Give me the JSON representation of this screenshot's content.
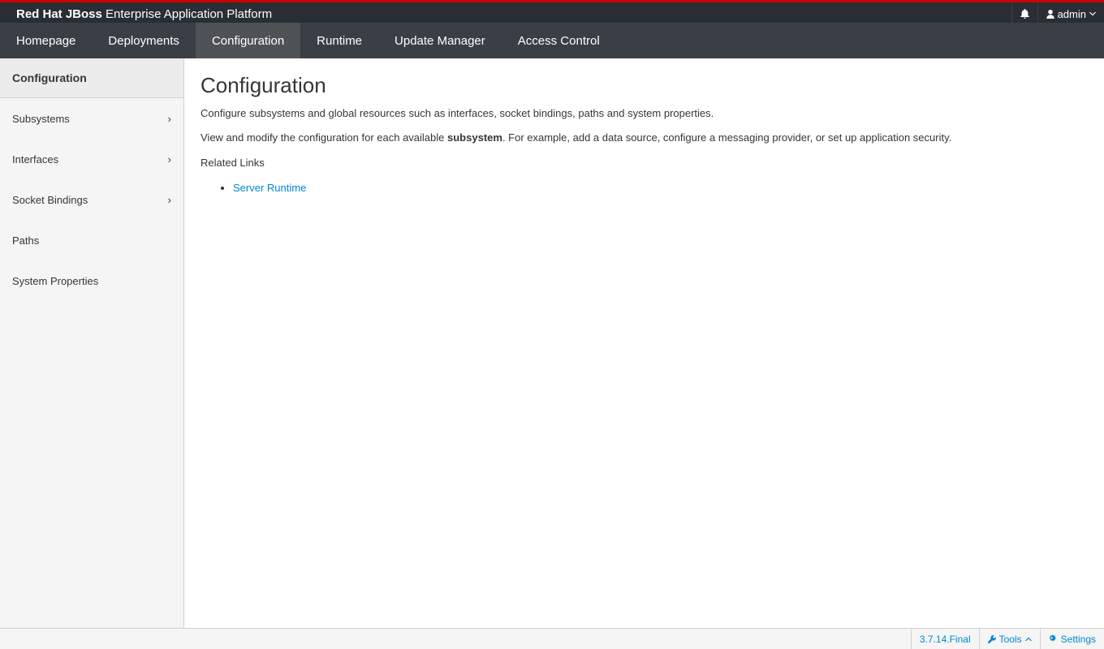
{
  "brand": {
    "bold": "Red Hat JBoss",
    "rest": " Enterprise Application Platform"
  },
  "utility": {
    "user": "admin",
    "icons": [
      "bell-icon",
      "user-icon",
      "chevron-down-icon"
    ]
  },
  "nav": {
    "tabs": [
      {
        "label": "Homepage"
      },
      {
        "label": "Deployments"
      },
      {
        "label": "Configuration",
        "active": true
      },
      {
        "label": "Runtime"
      },
      {
        "label": "Update Manager"
      },
      {
        "label": "Access Control"
      }
    ]
  },
  "sidebar": {
    "header": "Configuration",
    "items": [
      {
        "label": "Subsystems",
        "chevron": "›"
      },
      {
        "label": "Interfaces",
        "chevron": "›"
      },
      {
        "label": "Socket Bindings",
        "chevron": "›"
      },
      {
        "label": "Paths"
      },
      {
        "label": "System Properties"
      }
    ]
  },
  "main": {
    "title": "Configuration",
    "intro": "Configure subsystems and global resources such as interfaces, socket bindings, paths and system properties.",
    "view_pre": "View and modify the configuration for each available ",
    "view_bold": "subsystem",
    "view_post": ". For example, add a data source, configure a messaging provider, or set up application security.",
    "related_label": "Related Links",
    "links": [
      {
        "label": "Server Runtime"
      }
    ]
  },
  "footer": {
    "version": "3.7.14.Final",
    "tools": "Tools",
    "settings": "Settings"
  },
  "colors": {
    "accent": "#cc0000",
    "link": "#0088ce",
    "masthead": "#292e34",
    "nav": "#393f44"
  }
}
